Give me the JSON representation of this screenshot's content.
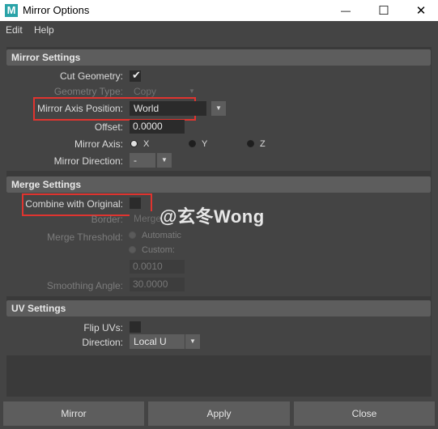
{
  "window": {
    "app_icon": "M",
    "title": "Mirror Options",
    "minimize_icon": "—",
    "maximize_icon": "☐",
    "close_icon": "✕"
  },
  "menu": {
    "items": [
      "Edit",
      "Help"
    ]
  },
  "mirror_settings": {
    "header": "Mirror Settings",
    "cut_geometry": {
      "label": "Cut Geometry:",
      "checked": true,
      "check": "✔"
    },
    "geometry_type": {
      "label": "Geometry Type:",
      "value": "Copy",
      "enabled": false
    },
    "mirror_axis_position": {
      "label": "Mirror Axis Position:",
      "value": "World"
    },
    "offset": {
      "label": "Offset:",
      "value": "0.0000"
    },
    "mirror_axis": {
      "label": "Mirror Axis:",
      "options": [
        "X",
        "Y",
        "Z"
      ],
      "selected": "X"
    },
    "mirror_direction": {
      "label": "Mirror Direction:",
      "value": "-"
    }
  },
  "merge_settings": {
    "header": "Merge Settings",
    "combine_with_original": {
      "label": "Combine with Original:",
      "checked": false
    },
    "border": {
      "label": "Border:",
      "value": "Merge",
      "enabled": false
    },
    "merge_threshold": {
      "label": "Merge Threshold:",
      "options": [
        "Automatic",
        "Custom:"
      ],
      "selected": "Automatic",
      "value": "0.0010",
      "enabled": false
    },
    "smoothing_angle": {
      "label": "Smoothing Angle:",
      "value": "30.0000",
      "enabled": false
    }
  },
  "uv_settings": {
    "header": "UV Settings",
    "flip_uvs": {
      "label": "Flip UVs:",
      "checked": false
    },
    "direction": {
      "label": "Direction:",
      "value": "Local U"
    }
  },
  "buttons": {
    "mirror": "Mirror",
    "apply": "Apply",
    "close": "Close"
  },
  "watermark": "@玄冬Wong",
  "colors": {
    "highlight_box": "#e0342f",
    "header_bg": "#5d5d5d",
    "window_bg": "#444444"
  }
}
